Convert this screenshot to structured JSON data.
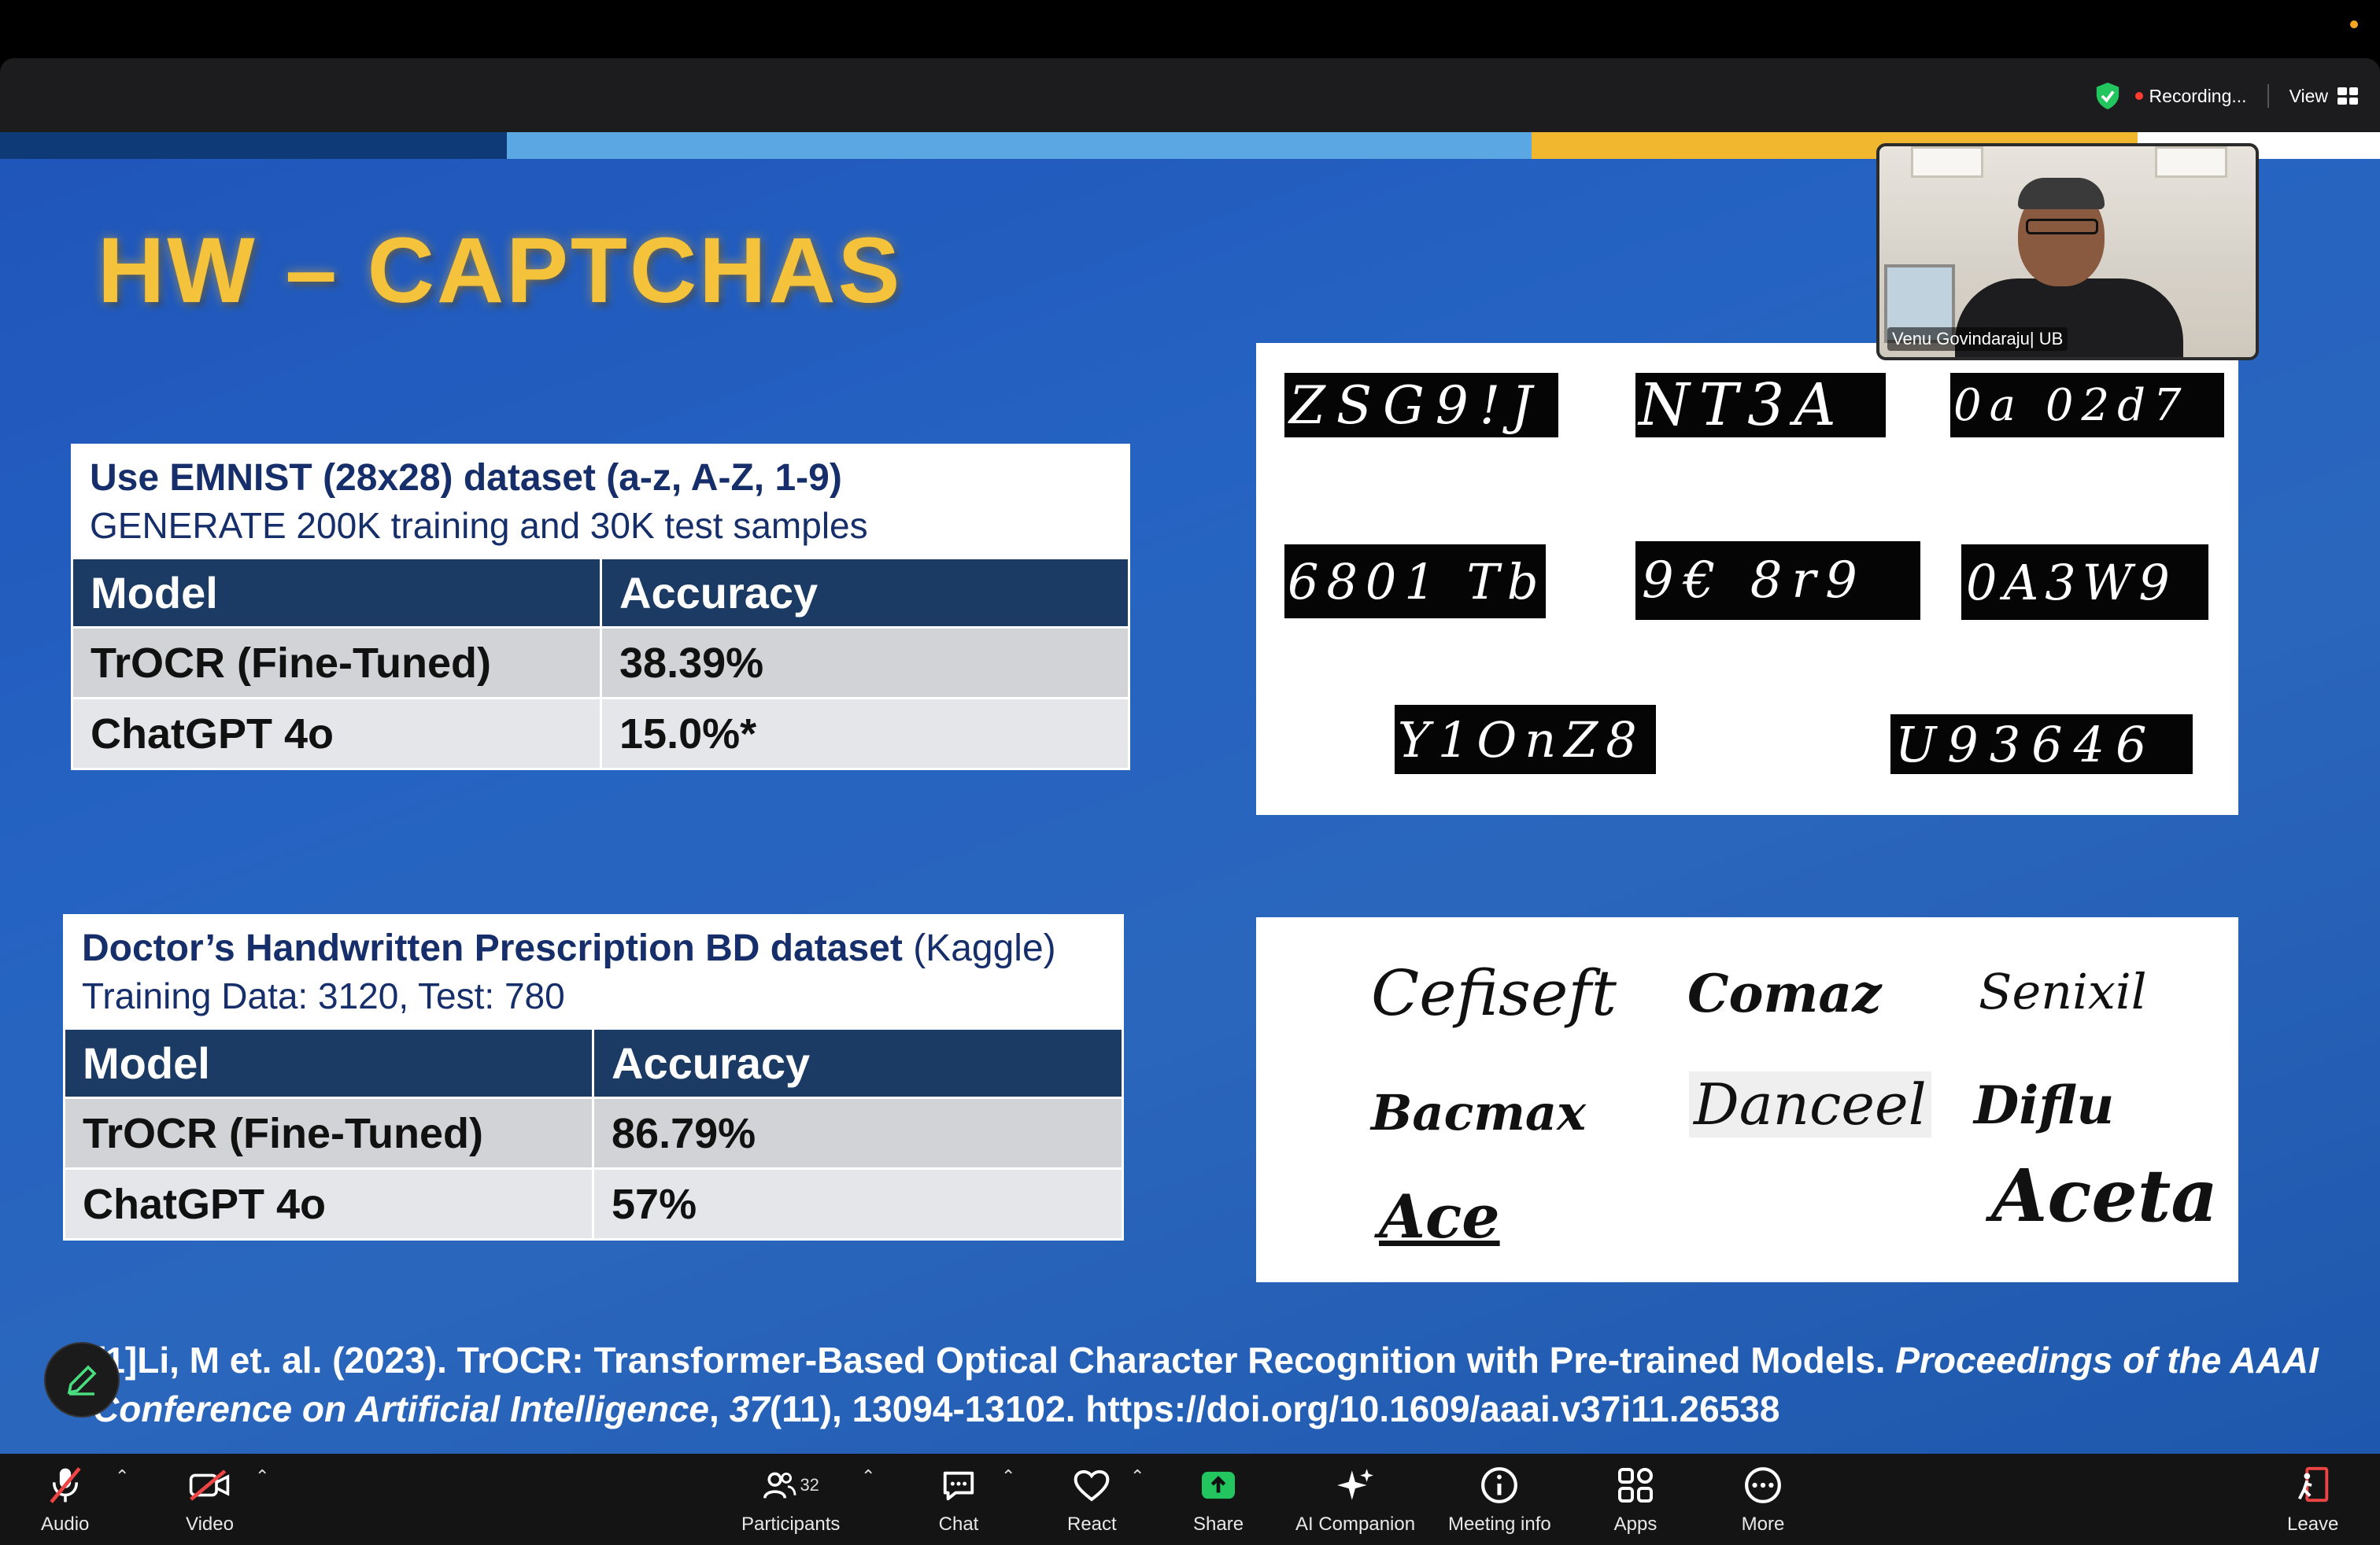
{
  "header": {
    "recording_label": "Recording...",
    "view_label": "View"
  },
  "slide": {
    "title": "HW – CAPTCHAS",
    "table1": {
      "heading_bold": "Use EMNIST (28x28) dataset (a-z, A-Z, 1-9)",
      "heading_line2": "GENERATE 200K training and 30K test samples",
      "columns": [
        "Model",
        "Accuracy"
      ],
      "rows": [
        [
          "TrOCR (Fine-Tuned)",
          "38.39%"
        ],
        [
          "ChatGPT 4o",
          "15.0%*"
        ]
      ]
    },
    "table2": {
      "heading_bold": "Doctor’s Handwritten Prescription BD dataset",
      "heading_suffix": " (Kaggle)",
      "heading_line2": "Training Data: 3120, Test: 780",
      "columns": [
        "Model",
        "Accuracy"
      ],
      "rows": [
        [
          "TrOCR (Fine-Tuned)",
          "86.79%"
        ],
        [
          "ChatGPT 4o",
          "57%"
        ]
      ]
    },
    "captcha_samples": [
      "ZSG9!J",
      "NT3A",
      "0a 02d7",
      "6801 Tb",
      "9€ 8r9",
      "0A3W9",
      "Y1OnZ8",
      "U93646"
    ],
    "prescription_words": [
      "Cefiseft",
      "Comaz",
      "Senixil",
      "Bacmax",
      "Danceel",
      "Diflu",
      "Ace",
      "Aceta"
    ],
    "citation": {
      "prefix": "[1]Li, M et. al. (2023). TrOCR: Transformer-Based Optical Character Recognition with Pre-trained Models. ",
      "journal": "Proceedings of the AAAI Conference on Artificial Intelligence",
      "sep": ", ",
      "volume": "37",
      "rest": "(11), 13094-13102. https://doi.org/10.1609/aaai.v37i11.26538"
    }
  },
  "video": {
    "participant_name": "Venu Govindaraju| UB"
  },
  "toolbar": {
    "audio": "Audio",
    "video": "Video",
    "participants": "Participants",
    "participants_count": "32",
    "chat": "Chat",
    "react": "React",
    "share": "Share",
    "ai_companion": "AI Companion",
    "meeting_info": "Meeting info",
    "apps": "Apps",
    "more": "More",
    "leave": "Leave"
  },
  "colors": {
    "title": "#f5c33b",
    "table_header": "#1b3a64",
    "share_green": "#22c55e",
    "recording_red": "#ff3b30"
  }
}
